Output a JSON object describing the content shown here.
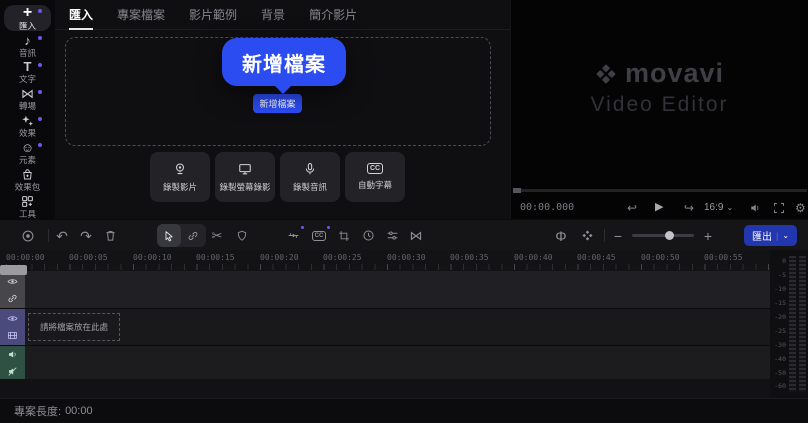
{
  "sidebar": {
    "items": [
      {
        "label": "匯入",
        "icon": "plus-icon",
        "glyph": "+",
        "badge": true,
        "active": true
      },
      {
        "label": "音訊",
        "icon": "music-note-icon",
        "glyph": "♪",
        "badge": true,
        "active": false
      },
      {
        "label": "文字",
        "icon": "text-icon",
        "glyph": "T",
        "badge": true,
        "active": false
      },
      {
        "label": "轉場",
        "icon": "transition-icon",
        "glyph": "⋈",
        "badge": true,
        "active": false
      },
      {
        "label": "效果",
        "icon": "sparkles-icon",
        "glyph": "✦",
        "badge": true,
        "active": false
      },
      {
        "label": "元素",
        "icon": "smiley-icon",
        "glyph": "☺",
        "badge": true,
        "active": false
      },
      {
        "label": "效果包",
        "icon": "effect-pack-icon",
        "glyph": "⛁",
        "badge": false,
        "active": false
      },
      {
        "label": "工具",
        "icon": "tools-grid-icon",
        "glyph": "⊞",
        "badge": false,
        "active": false
      }
    ]
  },
  "tabs": {
    "active": "匯入",
    "items": [
      {
        "label": "匯入"
      },
      {
        "label": "專案檔案"
      },
      {
        "label": "影片範例"
      },
      {
        "label": "背景"
      },
      {
        "label": "簡介影片"
      }
    ]
  },
  "import_panel": {
    "tooltip_label": "新增檔案",
    "add_file_button": "新增檔案",
    "record_buttons": [
      {
        "label": "錄製影片",
        "icon": "webcam-icon"
      },
      {
        "label": "錄製螢幕錄影",
        "icon": "screen-record-icon"
      },
      {
        "label": "錄製音訊",
        "icon": "microphone-icon"
      },
      {
        "label": "自動字幕",
        "icon": "subtitles-cc-icon",
        "cc_text": "CC"
      }
    ]
  },
  "preview": {
    "brand": "movavi",
    "product": "Video Editor",
    "timecode": "00:00.000",
    "aspect_ratio": "16:9",
    "icons": {
      "skip_back": "↩",
      "play": "▶",
      "skip_forward": "↪",
      "chevron": "⌄",
      "gear": "⚙"
    }
  },
  "toolbar": {
    "export_label": "匯出",
    "export_divider": "|",
    "export_chevron": "⌄",
    "icons": {
      "undo": "↶",
      "redo": "↷",
      "scissors": "✂",
      "transition": "⋈",
      "audio_phi": "Φ",
      "minus": "−",
      "plus": "+",
      "cc": "CC"
    }
  },
  "timeline": {
    "ruler_labels": [
      "00:00:00",
      "00:00:05",
      "00:00:10",
      "00:00:15",
      "00:00:20",
      "00:00:25",
      "00:00:30",
      "00:00:35",
      "00:00:40",
      "00:00:45",
      "00:00:50",
      "00:00:55"
    ],
    "drop_hint": "請將檔案放在此處",
    "db_scale": [
      "0",
      "-5",
      "-10",
      "-15",
      "-20",
      "-25",
      "-30",
      "-40",
      "-50",
      "-60"
    ]
  },
  "status_bar": {
    "project_length_label": "專案長度:",
    "project_length_value": "00:00"
  },
  "colors": {
    "accent_blue": "#2b4cf0",
    "export_blue": "#2236ae",
    "badge_purple": "#6d58e8",
    "track_overlay_header": "#47474b",
    "track_video_header": "#4b4a7d",
    "track_audio_header": "#2e5144",
    "background": "#0c0c0e"
  }
}
